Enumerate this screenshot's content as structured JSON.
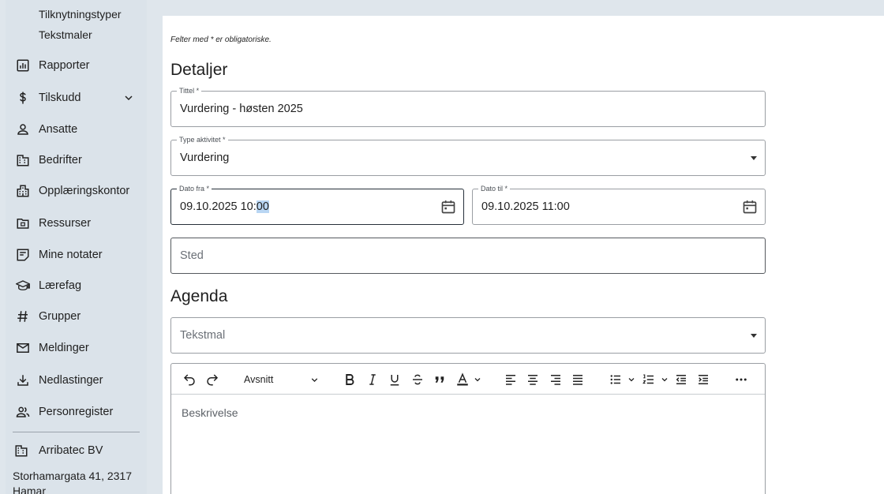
{
  "sidebar": {
    "sub_items": [
      "Tilknytningstyper",
      "Tekstmaler"
    ],
    "items": [
      {
        "label": "Rapporter",
        "icon": "report-icon"
      },
      {
        "label": "Tilskudd",
        "icon": "dollar-icon",
        "expandable": true
      },
      {
        "label": "Ansatte",
        "icon": "person-icon"
      },
      {
        "label": "Bedrifter",
        "icon": "building-icon"
      },
      {
        "label": "Opplæringskontor",
        "icon": "office-icon"
      },
      {
        "label": "Ressurser",
        "icon": "folder-icon"
      },
      {
        "label": "Mine notater",
        "icon": "note-icon"
      },
      {
        "label": "Lærefag",
        "icon": "school-icon"
      },
      {
        "label": "Grupper",
        "icon": "hashtag-icon"
      },
      {
        "label": "Meldinger",
        "icon": "mail-icon"
      },
      {
        "label": "Nedlastinger",
        "icon": "download-icon"
      },
      {
        "label": "Personregister",
        "icon": "people-icon"
      }
    ],
    "organization": {
      "label": "Arribatec BV",
      "icon": "building-icon"
    },
    "address": "Storhamargata 41, 2317 Hamar"
  },
  "form": {
    "required_note": "Felter med * er obligatoriske.",
    "details_title": "Detaljer",
    "title_field": {
      "label": "Tittel *",
      "value": "Vurdering - høsten 2025"
    },
    "activity_type": {
      "label": "Type aktivitet *",
      "value": "Vurdering"
    },
    "date_from": {
      "label": "Dato fra *",
      "value_prefix": "09.10.2025 10:",
      "value_selected": "00"
    },
    "date_to": {
      "label": "Dato til *",
      "value": "09.10.2025 11:00"
    },
    "location": {
      "placeholder": "Sted"
    },
    "agenda_title": "Agenda",
    "text_template": {
      "placeholder": "Tekstmal"
    },
    "editor": {
      "block_format": "Avsnitt",
      "placeholder": "Beskrivelse"
    }
  },
  "colors": {
    "sidebar_bg": "#dbe3ea",
    "main_bg": "#ffffff",
    "selection": "#b9d6f3"
  }
}
